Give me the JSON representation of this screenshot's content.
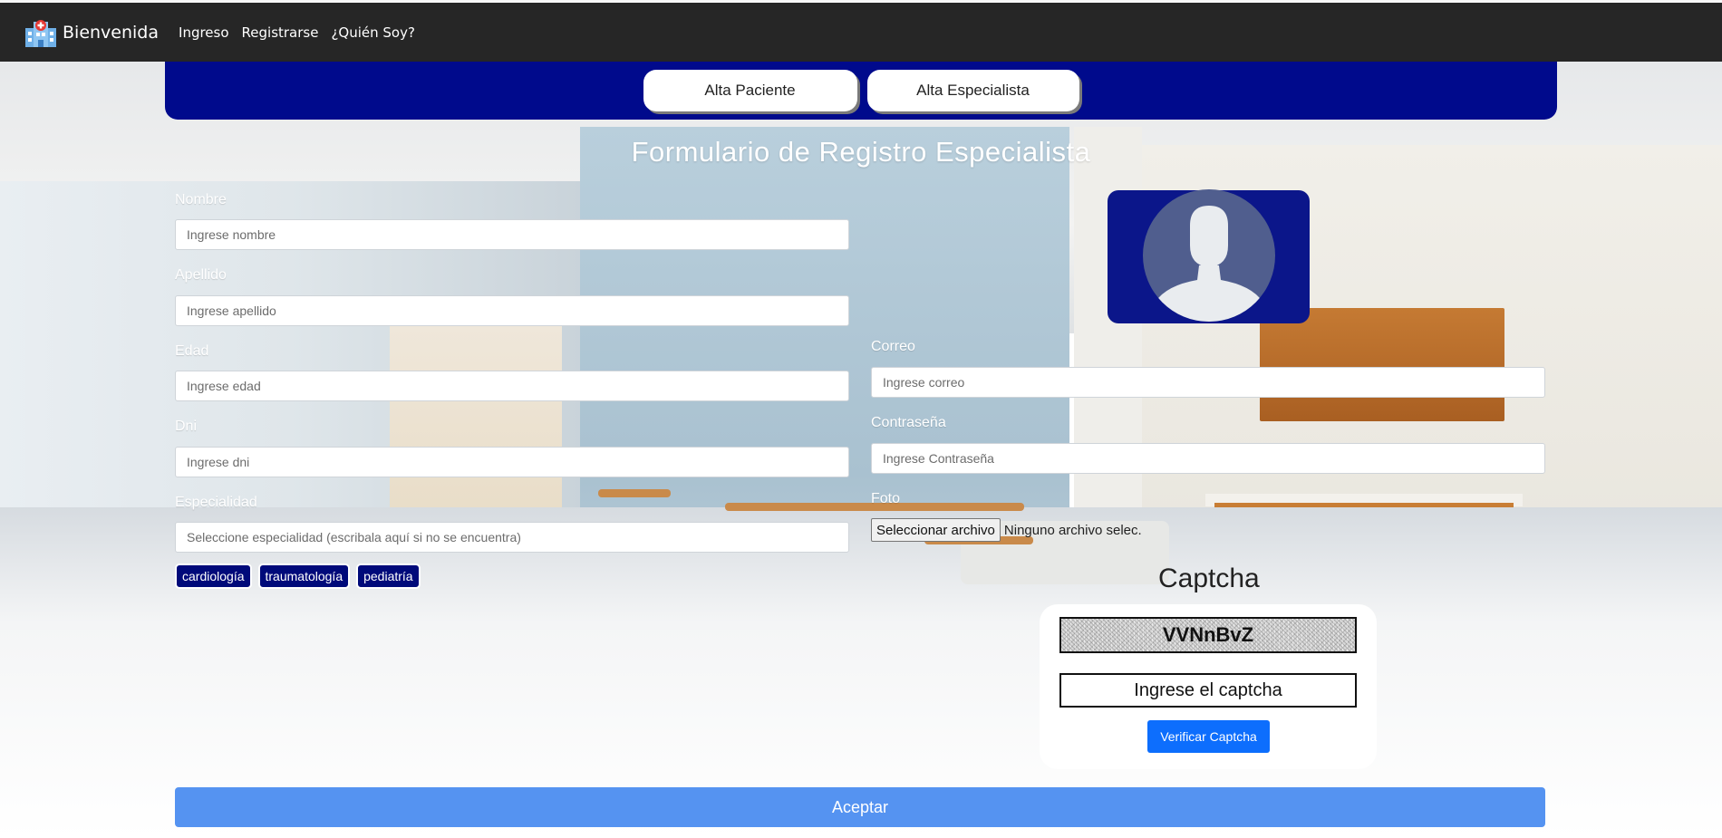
{
  "navbar": {
    "brand": "Bienvenida",
    "links": [
      "Ingreso",
      "Registrarse",
      "¿Quién Soy?"
    ]
  },
  "switch_bar": {
    "paciente_label": "Alta Paciente",
    "especialista_label": "Alta Especialista"
  },
  "form": {
    "title": "Formulario de Registro Especialista",
    "nombre": {
      "label": "Nombre",
      "placeholder": "Ingrese nombre",
      "value": ""
    },
    "apellido": {
      "label": "Apellido",
      "placeholder": "Ingrese apellido",
      "value": ""
    },
    "edad": {
      "label": "Edad",
      "placeholder": "Ingrese edad",
      "value": ""
    },
    "dni": {
      "label": "Dni",
      "placeholder": "Ingrese dni",
      "value": ""
    },
    "especialidad": {
      "label": "Especialidad",
      "placeholder": "Seleccione especialidad (escribala aquí si no se encuentra)",
      "value": "",
      "options": [
        "cardiología",
        "traumatología",
        "pediatría"
      ]
    },
    "correo": {
      "label": "Correo",
      "placeholder": "Ingrese correo",
      "value": ""
    },
    "contrasena": {
      "label": "Contraseña",
      "placeholder": "Ingrese Contraseña",
      "value": ""
    },
    "foto": {
      "label": "Foto",
      "button": "Seleccionar archivo",
      "status": "Ninguno archivo selec."
    },
    "submit_label": "Aceptar"
  },
  "captcha": {
    "title": "Captcha",
    "code": "VVNnBvZ",
    "placeholder": "Ingrese el captcha",
    "verify_label": "Verificar Captcha"
  },
  "colors": {
    "navbar": "#262626",
    "switch_bar": "#000a8c",
    "chip": "#000a7a",
    "avatar_bg": "#0b168a",
    "verify_button": "#0d6efd",
    "submit_button": "#5593f1"
  },
  "icons": {
    "brand": "hospital-icon",
    "avatar": "user-silhouette-icon"
  }
}
